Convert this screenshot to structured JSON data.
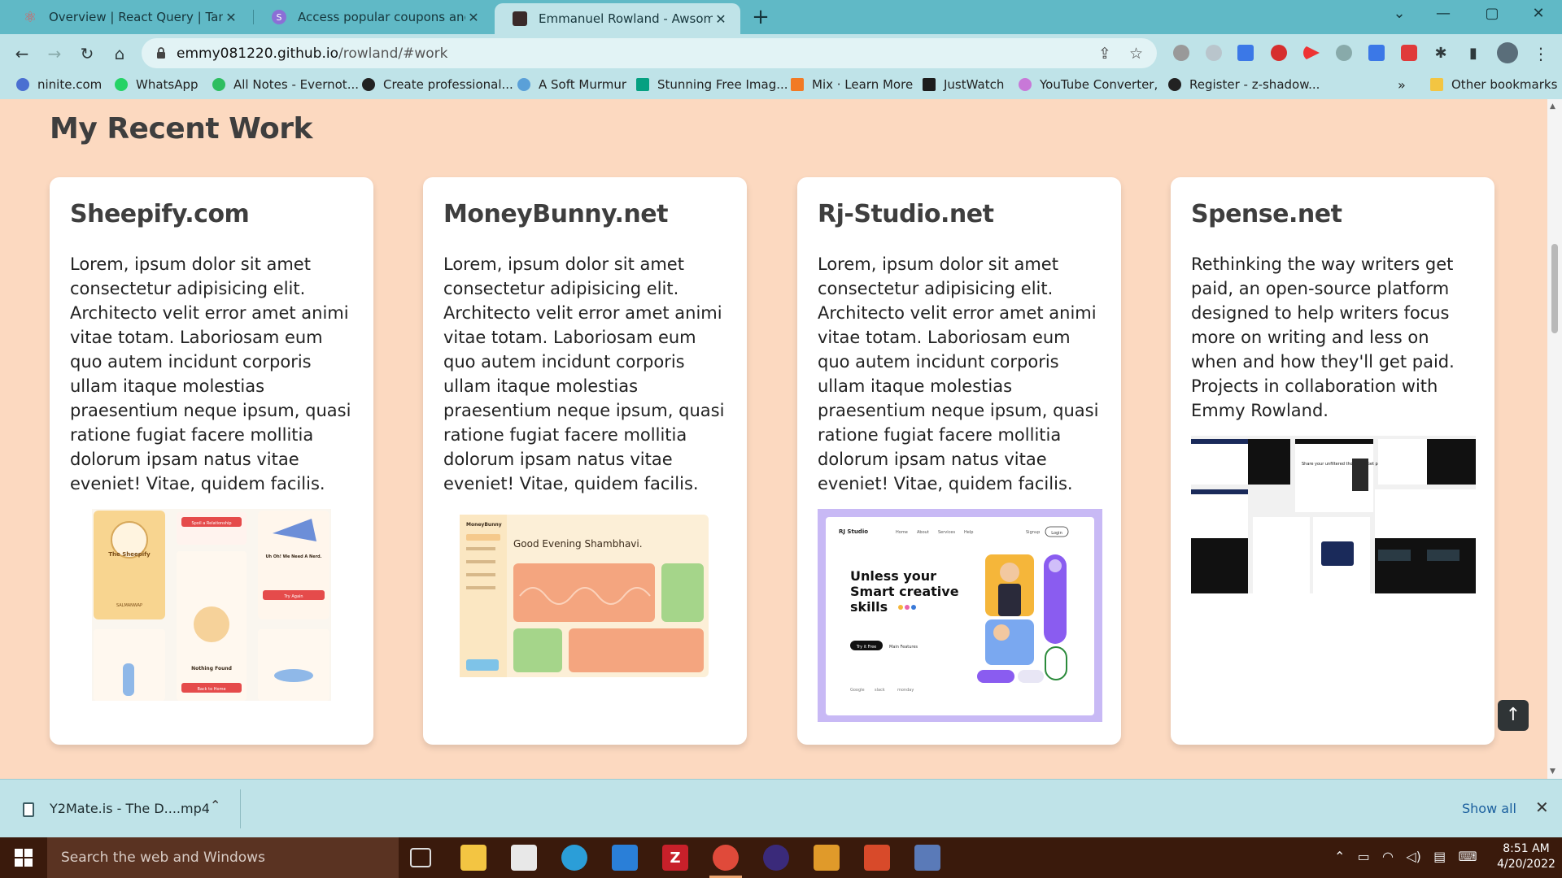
{
  "browser": {
    "tabs": [
      {
        "title": "Overview | React Query | TanStack",
        "close": "✕",
        "icon": "react-icon"
      },
      {
        "title": "Access popular coupons and cashback",
        "close": "✕",
        "icon": "coupon-icon"
      },
      {
        "title": "Emmanuel Rowland - Awsome Work",
        "close": "✕",
        "icon": "github-icon",
        "active": true
      }
    ],
    "new_tab": "+",
    "url_host": "emmy081220.github.io",
    "url_path": "/rowland/#work",
    "bookmarks": [
      {
        "label": "ninite.com",
        "color": "#4a6fd1"
      },
      {
        "label": "WhatsApp",
        "color": "#25d366"
      },
      {
        "label": "All Notes - Evernot...",
        "color": "#2dbe60"
      },
      {
        "label": "Create professional...",
        "color": "#222222"
      },
      {
        "label": "A Soft Murmur",
        "color": "#5aa0d8"
      },
      {
        "label": "Stunning Free Imag...",
        "color": "#05a081"
      },
      {
        "label": "Mix · Learn More",
        "color": "#f27a24"
      },
      {
        "label": "JustWatch",
        "color": "#1c1c1c"
      },
      {
        "label": "YouTube Converter,",
        "color": "#c878d8"
      },
      {
        "label": "Register - z-shadow...",
        "color": "#222222"
      }
    ],
    "bookmarks_more": "»",
    "other_bookmarks": "Other bookmarks"
  },
  "page": {
    "section_title": "My Recent Work",
    "projects": [
      {
        "title": "Sheepify.com",
        "description": "Lorem, ipsum dolor sit amet consectetur adipisicing elit. Architecto velit error amet animi vitae totam. Laboriosam eum quo autem incidunt corporis ullam itaque molestias praesentium neque ipsum, quasi ratione fugiat facere mollitia dolorum ipsam natus vitae eveniet! Vitae, quidem facilis.",
        "preview": {
          "app_name": "The Sheepify",
          "screen_1": "SALMANWAP",
          "btn_1": "Spoil a Relationship",
          "heading_2": "Uh Oh! We Need A Nerd.",
          "btn_2": "Try Again",
          "heading_3": "Nothing Found",
          "btn_3": "Back to Home"
        }
      },
      {
        "title": "MoneyBunny.net",
        "description": "Lorem, ipsum dolor sit amet consectetur adipisicing elit. Architecto velit error amet animi vitae totam. Laboriosam eum quo autem incidunt corporis ullam itaque molestias praesentium neque ipsum, quasi ratione fugiat facere mollitia dolorum ipsam natus vitae eveniet! Vitae, quidem facilis.",
        "preview": {
          "logo": "MoneyBunny",
          "greeting": "Good Evening Shambhavi."
        }
      },
      {
        "title": "Rj-Studio.net",
        "description": "Lorem, ipsum dolor sit amet consectetur adipisicing elit. Architecto velit error amet animi vitae totam. Laboriosam eum quo autem incidunt corporis ullam itaque molestias praesentium neque ipsum, quasi ratione fugiat facere mollitia dolorum ipsam natus vitae eveniet! Vitae, quidem facilis.",
        "preview": {
          "logo": "RJ Studio",
          "nav": [
            "Home",
            "About",
            "Services",
            "Help"
          ],
          "signup": "Signup",
          "login": "Login",
          "headline_1": "Unless your",
          "headline_2": "Smart creative",
          "headline_3": "skills",
          "cta": "Try it Free",
          "cta_2": "Main Features",
          "partners": [
            "Google",
            "slack",
            "monday"
          ]
        }
      },
      {
        "title": "Spense.net",
        "description": "Rethinking the way writers get paid, an open-source platform designed to help writers focus more on writing and less on when and how they'll get paid. Projects in collaboration with Emmy Rowland.",
        "preview": {
          "hero_text": "Share your unfiltered thoughts. Get paid."
        }
      }
    ],
    "back_to_top": "↑"
  },
  "downloads": {
    "file_name": "Y2Mate.is - The D....mp4",
    "show_all": "Show all",
    "close": "✕"
  },
  "taskbar": {
    "search_placeholder": "Search the web and Windows",
    "time": "8:51 AM",
    "date": "4/20/2022"
  }
}
